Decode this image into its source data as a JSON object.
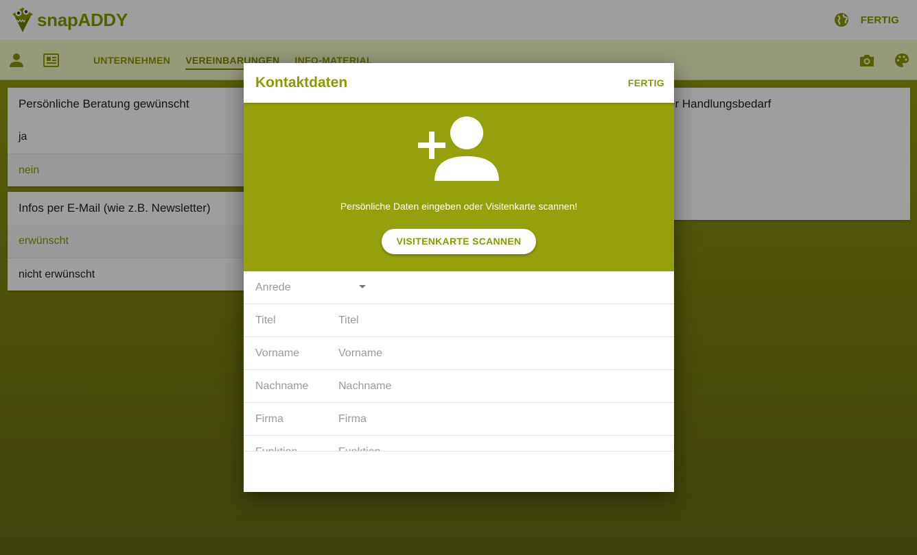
{
  "app": {
    "logo_text": "snapADDY",
    "top_done": "FERTIG"
  },
  "nav": {
    "tabs": [
      {
        "label": "UNTERNEHMEN"
      },
      {
        "label": "VEREINBARUNGEN"
      },
      {
        "label": "INFO-MATERIAL"
      }
    ]
  },
  "cards": {
    "beratung": {
      "title": "Persönliche Beratung gewünscht",
      "options": [
        "ja",
        "nein"
      ]
    },
    "email": {
      "title": "Infos per E-Mail (wie z.B. Newsletter)",
      "options": [
        "erwünscht",
        "nicht erwünscht"
      ]
    },
    "handlung": {
      "title": "er Handlungsbedarf"
    }
  },
  "modal": {
    "title": "Kontaktdaten",
    "done": "FERTIG",
    "hero_text": "Persönliche Daten eingeben oder Visitenkarte scannen!",
    "scan_button": "VISITENKARTE SCANNEN",
    "salutation_label": "Anrede",
    "fields": [
      {
        "label": "Titel",
        "placeholder": "Titel"
      },
      {
        "label": "Vorname",
        "placeholder": "Vorname"
      },
      {
        "label": "Nachname",
        "placeholder": "Nachname"
      },
      {
        "label": "Firma",
        "placeholder": "Firma"
      },
      {
        "label": "Funktion",
        "placeholder": "Funktion"
      }
    ]
  },
  "colors": {
    "brand": "#8a9a00",
    "hero": "#96a00b",
    "nav_bg": "#f3f6c6"
  }
}
